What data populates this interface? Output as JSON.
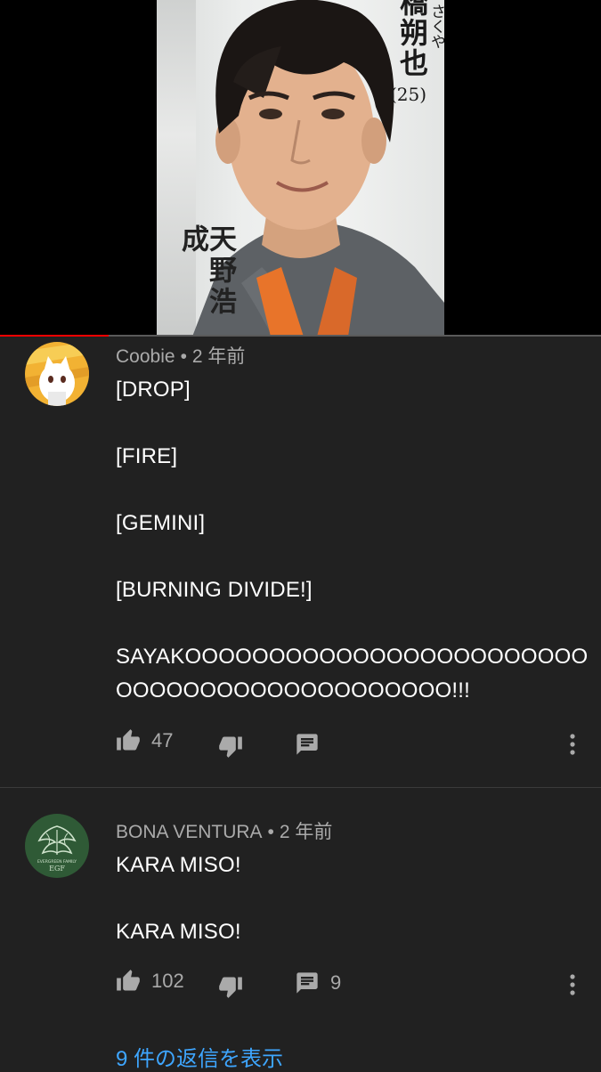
{
  "video": {
    "photo_text": {
      "name": "橋朔也",
      "furigana": "さくや",
      "age": "(25)",
      "actor": "天野浩成"
    },
    "progress": 0.18
  },
  "comments": [
    {
      "author": "Coobie",
      "separator": "•",
      "time": "2 年前",
      "lines": [
        "[DROP]",
        "[FIRE]",
        "[GEMINI]",
        "[BURNING DIVIDE!]",
        "SAYAKOOOOOOOOOOOOOOOOOOOOOOOO",
        "OOOOOOOOOOOOOOOOOOOO!!!"
      ],
      "likes": "47",
      "replies": ""
    },
    {
      "author": "BONA VENTURA",
      "separator": "•",
      "time": "2 年前",
      "lines": [
        "KARA MISO!",
        "KARA MISO!"
      ],
      "likes": "102",
      "replies": "9",
      "avatar_text": {
        "line1": "EVERGREEN FAMILY",
        "line2": "EGF"
      },
      "view_replies": "9 件の返信を表示"
    }
  ],
  "colors": {
    "background": "#212121",
    "meta": "#aaaaaa",
    "link": "#3ea6ff",
    "progress": "#ff0000"
  }
}
